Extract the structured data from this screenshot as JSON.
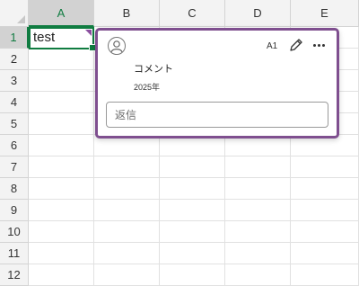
{
  "columns": [
    "A",
    "B",
    "C",
    "D",
    "E"
  ],
  "rows": [
    "1",
    "2",
    "3",
    "4",
    "5",
    "6",
    "7",
    "8",
    "9",
    "10",
    "11",
    "12"
  ],
  "selected_column": "A",
  "selected_row": "1",
  "cell_a1": {
    "value": "test"
  },
  "comment": {
    "cell_ref": "A1",
    "text": "コメント",
    "date": "2025年",
    "reply_placeholder": "返信",
    "icons": {
      "avatar": "person-avatar-icon",
      "edit": "pencil-icon",
      "more": "more-options-icon"
    }
  },
  "colors": {
    "accent": "#107c41",
    "comment_border": "#7f4f8f",
    "comment_flag": "#8b4f9f"
  }
}
